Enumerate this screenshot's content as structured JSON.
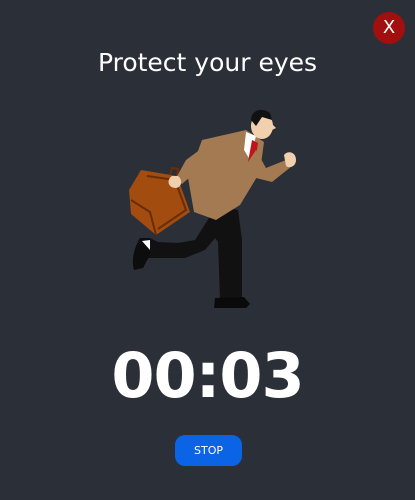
{
  "close_button": {
    "label": "X"
  },
  "title": "Protect your eyes",
  "illustration": {
    "icon": "running-businessman-illustration"
  },
  "timer": {
    "value": "00:03"
  },
  "stop_button": {
    "label": "STOP"
  },
  "colors": {
    "background": "#2b2f38",
    "close_button": "#a20f0f",
    "stop_button": "#0b63e6",
    "text": "#ffffff"
  }
}
